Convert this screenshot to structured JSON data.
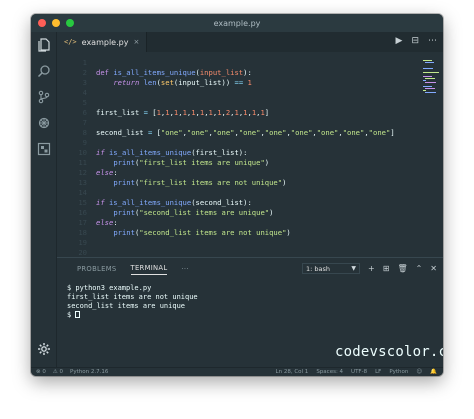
{
  "window": {
    "title": "example.py"
  },
  "tab": {
    "icon_text": "</>",
    "label": "example.py",
    "close": "×"
  },
  "editor_actions": [
    "▶",
    "⊟",
    "⋯"
  ],
  "code_lines": [
    {
      "num": "1",
      "html": ""
    },
    {
      "num": "2",
      "html": "<span style='color:#c792ea'>def</span> <span style='color:#82aaff'>is_all_items_unique</span>(<span style='color:#f78c6c'>input_list</span>):"
    },
    {
      "num": "3",
      "html": "    <span style='color:#c792ea;font-style:italic'>return</span> <span style='color:#82aaff'>len</span>(<span style='color:#ffcb6b'>set</span>(input_list)) <span style='color:#89ddff'>==</span> <span style='color:#f78c6c'>1</span>"
    },
    {
      "num": "4",
      "html": ""
    },
    {
      "num": "5",
      "html": ""
    },
    {
      "num": "6",
      "html": "first_list <span style='color:#89ddff'>=</span> [<span style='color:#f78c6c'>1</span>,<span style='color:#f78c6c'>1</span>,<span style='color:#f78c6c'>1</span>,<span style='color:#f78c6c'>1</span>,<span style='color:#f78c6c'>1</span>,<span style='color:#f78c6c'>1</span>,<span style='color:#f78c6c'>1</span>,<span style='color:#f78c6c'>1</span>,<span style='color:#f78c6c'>2</span>,<span style='color:#f78c6c'>1</span>,<span style='color:#f78c6c'>1</span>,<span style='color:#f78c6c'>1</span>,<span style='color:#f78c6c'>1</span>]"
    },
    {
      "num": "7",
      "html": ""
    },
    {
      "num": "8",
      "html": "second_list <span style='color:#89ddff'>=</span> [<span style='color:#c3e88d'>\"one\"</span>,<span style='color:#c3e88d'>\"one\"</span>,<span style='color:#c3e88d'>\"one\"</span>,<span style='color:#c3e88d'>\"one\"</span>,<span style='color:#c3e88d'>\"one\"</span>,<span style='color:#c3e88d'>\"one\"</span>,<span style='color:#c3e88d'>\"one\"</span>,<span style='color:#c3e88d'>\"one\"</span>,<span style='color:#c3e88d'>\"one\"</span>]"
    },
    {
      "num": "9",
      "html": ""
    },
    {
      "num": "10",
      "html": "<span style='color:#c792ea;font-style:italic'>if</span> <span style='color:#82aaff'>is_all_items_unique</span>(first_list):"
    },
    {
      "num": "11",
      "html": "    <span style='color:#82aaff'>print</span>(<span style='color:#c3e88d'>\"first_list items are unique\"</span>)"
    },
    {
      "num": "12",
      "html": "<span style='color:#c792ea;font-style:italic'>else</span>:"
    },
    {
      "num": "13",
      "html": "    <span style='color:#82aaff'>print</span>(<span style='color:#c3e88d'>\"first_list items are not unique\"</span>)"
    },
    {
      "num": "14",
      "html": ""
    },
    {
      "num": "15",
      "html": "<span style='color:#c792ea;font-style:italic'>if</span> <span style='color:#82aaff'>is_all_items_unique</span>(second_list):"
    },
    {
      "num": "16",
      "html": "    <span style='color:#82aaff'>print</span>(<span style='color:#c3e88d'>\"second_list items are unique\"</span>)"
    },
    {
      "num": "17",
      "html": "<span style='color:#c792ea;font-style:italic'>else</span>:"
    },
    {
      "num": "18",
      "html": "    <span style='color:#82aaff'>print</span>(<span style='color:#c3e88d'>\"second_list items are not unique\"</span>)"
    },
    {
      "num": "19",
      "html": ""
    },
    {
      "num": "20",
      "html": ""
    }
  ],
  "panel": {
    "tabs": [
      "PROBLEMS",
      "TERMINAL",
      "···"
    ],
    "shell": "1: bash",
    "actions": [
      "+",
      "⊞",
      "🗑",
      "⌃",
      "✕"
    ]
  },
  "terminal": {
    "lines": [
      "$ python3 example.py",
      "first_list items are not unique",
      "second_list items are unique"
    ],
    "prompt": "$ "
  },
  "watermark": "codevscolor.com",
  "status": {
    "errors": "⊗ 0",
    "warnings": "⚠ 0",
    "interpreter": "Python 2.7.16",
    "position": "Ln 28, Col 1",
    "spaces": "Spaces: 4",
    "encoding": "UTF-8",
    "eol": "LF",
    "language": "Python",
    "feedback": "☺",
    "bell": "🔔"
  },
  "colors": {
    "background": "#263238",
    "keyword": "#c792ea",
    "function": "#82aaff",
    "string": "#c3e88d",
    "number": "#f78c6c",
    "operator": "#89ddff",
    "builtin": "#ffcb6b"
  }
}
